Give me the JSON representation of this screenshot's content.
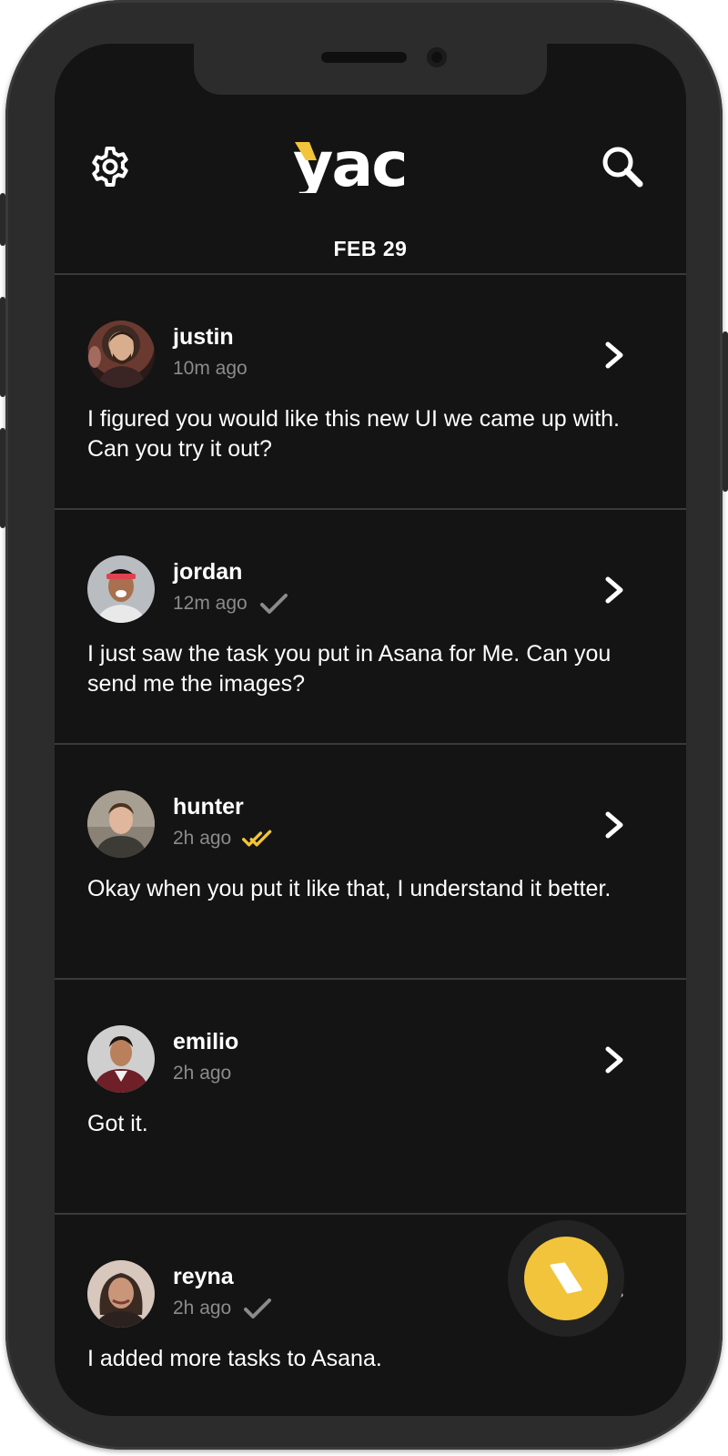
{
  "app": {
    "brand": "yac",
    "brand_colors": {
      "accent": "#f2c43b",
      "text": "#ffffff",
      "background": "#141414"
    }
  },
  "header": {
    "settings_icon": "gear-icon",
    "search_icon": "search-icon",
    "date": "FEB 29"
  },
  "messages": [
    {
      "name": "justin",
      "time": "10m ago",
      "status": "none",
      "text": "I figured you would like this new UI we came up with. Can you try it out?"
    },
    {
      "name": "jordan",
      "time": "12m ago",
      "status": "sent",
      "text": "I just saw the task you put in Asana for Me. Can you send me the images?"
    },
    {
      "name": "hunter",
      "time": "2h ago",
      "status": "read",
      "text": "Okay when you put it like that, I understand it better."
    },
    {
      "name": "emilio",
      "time": "2h ago",
      "status": "none",
      "text": "Got it."
    },
    {
      "name": "reyna",
      "time": "2h ago",
      "status": "sent",
      "text": "I added more tasks to Asana."
    }
  ],
  "fab": {
    "icon": "record-icon"
  }
}
